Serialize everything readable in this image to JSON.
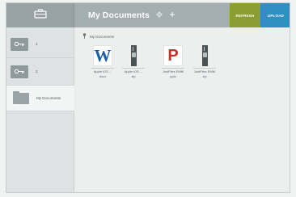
{
  "header": {
    "title": "My Documents",
    "icons": [
      "settings-icon",
      "add-icon"
    ],
    "refresh_label": "REFRESH",
    "upload_label": "UPLOAD"
  },
  "sidebar": {
    "items": [
      {
        "icon": "key-icon",
        "label": "1"
      },
      {
        "icon": "key-icon",
        "label": "2"
      },
      {
        "icon": "folder-icon",
        "label": "My Documents",
        "active": true
      }
    ]
  },
  "breadcrumb": {
    "icon": "pin-icon",
    "label": "My Documents"
  },
  "files": [
    {
      "icon": "word-doc-icon",
      "name_line1": "Apple iOS ...",
      "name_line2": "docx"
    },
    {
      "icon": "zip-icon",
      "name_line1": "Apple iOS ...",
      "name_line2": "zip"
    },
    {
      "icon": "powerpoint-icon",
      "name_line1": "JustFiles EMM",
      "name_line2": "pptx"
    },
    {
      "icon": "zip-icon",
      "name_line1": "JustFiles EMM",
      "name_line2": "zip"
    }
  ],
  "colors": {
    "topbar": "#a4aeb1",
    "refresh": "#8c9d32",
    "upload": "#2f8fc0",
    "word": "#1d5fa8",
    "powerpoint": "#c9302a"
  }
}
